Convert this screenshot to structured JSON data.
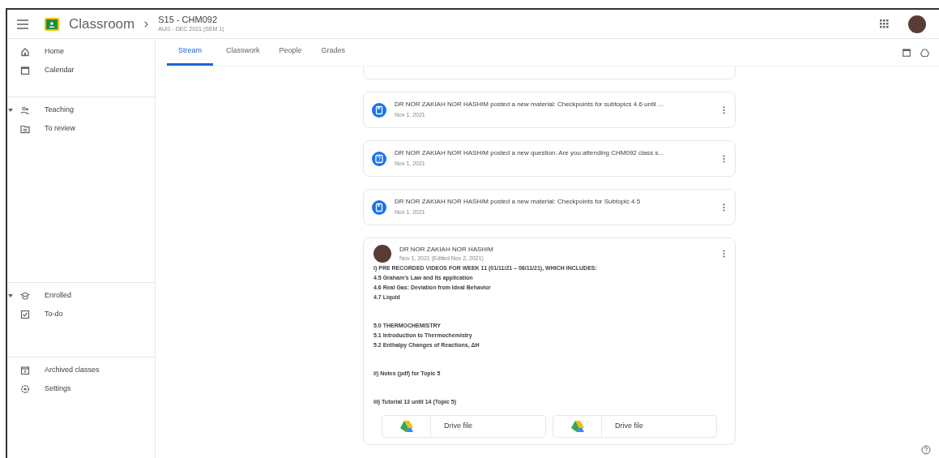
{
  "header": {
    "app_name": "Classroom",
    "class_name": "S15 - CHM092",
    "class_term": "AUG - DEC 2021 (SEM 1)"
  },
  "tabs": [
    {
      "label": "Stream",
      "selected": true
    },
    {
      "label": "Classwork",
      "selected": false
    },
    {
      "label": "People",
      "selected": false
    },
    {
      "label": "Grades",
      "selected": false
    }
  ],
  "sidebar": {
    "groups": [
      {
        "items": [
          {
            "label": "Home",
            "kind": "home"
          },
          {
            "label": "Calendar",
            "kind": "calendar"
          }
        ]
      },
      {
        "items": [
          {
            "label": "Teaching",
            "kind": "people",
            "expanded": true
          },
          {
            "label": "To review",
            "kind": "folder"
          }
        ]
      },
      {
        "items": [
          {
            "label": "Enrolled",
            "kind": "cap",
            "expanded": true
          },
          {
            "label": "To-do",
            "kind": "todo"
          }
        ]
      },
      {
        "items": [
          {
            "label": "Archived classes",
            "kind": "archive"
          },
          {
            "label": "Settings",
            "kind": "gear"
          }
        ]
      }
    ]
  },
  "feed": [
    {
      "kind": "material",
      "text": "DR NOR ZAKIAH NOR HASHIM posted a new material: Checkpoints for subtopics 4.6 until ...",
      "date": "Nov 1, 2021"
    },
    {
      "kind": "question",
      "text": "DR NOR ZAKIAH NOR HASHIM posted a new question: Are you attending CHM092 class s...",
      "date": "Nov 1, 2021"
    },
    {
      "kind": "material",
      "text": "DR NOR ZAKIAH NOR HASHIM posted a new material: Checkpoints for Subtopic 4.5",
      "date": "Nov 1, 2021"
    }
  ],
  "announcement": {
    "author": "DR NOR ZAKIAH NOR HASHIM",
    "date": "Nov 1, 2021 (Edited Nov 2, 2021)",
    "blocks": [
      [
        "i) PRE RECORDED VIDEOS FOR WEEK 11 (01/11/21 – 08/11/21), WHICH INCLUDES:",
        "4.5 Graham's Law and its application",
        "4.6 Real Gas: Deviation from Ideal Behavior",
        "4.7 Liquid"
      ],
      [
        "5.0 THERMOCHEMISTRY",
        "5.1 Introduction to Thermochemistry",
        "5.2 Enthalpy Changes of Reactions, ΔH"
      ],
      [
        "ii) Notes (pdf) for Topic 5"
      ],
      [
        "iii) Tutorial 13 until 14 (Topic 5)"
      ]
    ],
    "attachments": [
      {
        "label": "Drive file"
      },
      {
        "label": "Drive file"
      }
    ]
  }
}
